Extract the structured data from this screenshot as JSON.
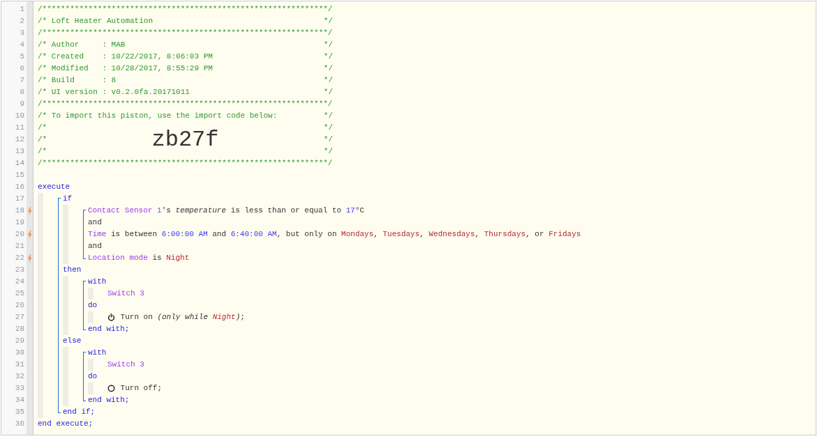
{
  "lines": [
    {
      "number": "1",
      "kind": "banner",
      "trigger": false,
      "tokens": [
        {
          "kind": "comment",
          "text": "/**************************************************************/"
        }
      ]
    },
    {
      "number": "2",
      "kind": "banner",
      "trigger": false,
      "tokens": [
        {
          "kind": "comment",
          "text": "/* Loft Heater Automation"
        },
        {
          "kind": "comment",
          "text": "*/"
        }
      ]
    },
    {
      "number": "3",
      "kind": "banner",
      "trigger": false,
      "tokens": [
        {
          "kind": "comment",
          "text": "/**************************************************************/"
        }
      ]
    },
    {
      "number": "4",
      "kind": "banner",
      "trigger": false,
      "tokens": [
        {
          "kind": "comment",
          "text": "/* Author     : MAB"
        },
        {
          "kind": "comment",
          "text": "*/"
        }
      ]
    },
    {
      "number": "5",
      "kind": "banner",
      "trigger": false,
      "tokens": [
        {
          "kind": "comment",
          "text": "/* Created    : 10/22/2017, 8:06:03 PM"
        },
        {
          "kind": "comment",
          "text": "*/"
        }
      ]
    },
    {
      "number": "6",
      "kind": "banner",
      "trigger": false,
      "tokens": [
        {
          "kind": "comment",
          "text": "/* Modified   : 10/28/2017, 8:55:29 PM"
        },
        {
          "kind": "comment",
          "text": "*/"
        }
      ]
    },
    {
      "number": "7",
      "kind": "banner",
      "trigger": false,
      "tokens": [
        {
          "kind": "comment",
          "text": "/* Build      : 8"
        },
        {
          "kind": "comment",
          "text": "*/"
        }
      ]
    },
    {
      "number": "8",
      "kind": "banner",
      "trigger": false,
      "tokens": [
        {
          "kind": "comment",
          "text": "/* UI version : v0.2.0fa.20171011"
        },
        {
          "kind": "comment",
          "text": "*/"
        }
      ]
    },
    {
      "number": "9",
      "kind": "banner",
      "trigger": false,
      "tokens": [
        {
          "kind": "comment",
          "text": "/**************************************************************/"
        }
      ]
    },
    {
      "number": "10",
      "kind": "banner",
      "trigger": false,
      "tokens": [
        {
          "kind": "comment",
          "text": "/* To import this piston, use the import code below:"
        },
        {
          "kind": "comment",
          "text": "*/"
        }
      ]
    },
    {
      "number": "11",
      "kind": "banner",
      "trigger": false,
      "tokens": [
        {
          "kind": "comment",
          "text": "/*"
        },
        {
          "kind": "comment",
          "text": "*/"
        }
      ]
    },
    {
      "number": "12",
      "kind": "banner",
      "trigger": false,
      "tokens": [
        {
          "kind": "comment",
          "text": "/*"
        },
        {
          "kind": "import_code",
          "text": "zb27f"
        },
        {
          "kind": "comment",
          "text": "*/"
        }
      ]
    },
    {
      "number": "13",
      "kind": "banner",
      "trigger": false,
      "tokens": [
        {
          "kind": "comment",
          "text": "/*"
        },
        {
          "kind": "comment",
          "text": "*/"
        }
      ]
    },
    {
      "number": "14",
      "kind": "banner",
      "trigger": false,
      "tokens": [
        {
          "kind": "comment",
          "text": "/**************************************************************/"
        }
      ]
    },
    {
      "number": "15",
      "kind": "code",
      "trigger": false
    },
    {
      "number": "16",
      "kind": "code",
      "trigger": false,
      "tokens": [
        {
          "kind": "keyword",
          "text": "execute"
        }
      ],
      "children": [
        {
          "kind": "block",
          "children": [
            {
              "number": "17",
              "kind": "code",
              "trigger": false,
              "tokens": [
                {
                  "kind": "keyword",
                  "text": "if"
                }
              ],
              "children": [
                {
                  "kind": "block",
                  "children": [
                    {
                      "number": "18",
                      "kind": "code",
                      "trigger": true,
                      "tokens": [
                        {
                          "kind": "device",
                          "text": "Contact Sensor 1"
                        },
                        {
                          "kind": "text",
                          "text": "'s "
                        },
                        {
                          "kind": "attribute",
                          "text": "temperature"
                        },
                        {
                          "kind": "text",
                          "text": " is less than or equal to "
                        },
                        {
                          "kind": "number",
                          "text": "17"
                        },
                        {
                          "kind": "text",
                          "text": "°C"
                        }
                      ]
                    },
                    {
                      "number": "19",
                      "kind": "code",
                      "trigger": false,
                      "tokens": [
                        {
                          "kind": "text",
                          "text": "and"
                        }
                      ]
                    },
                    {
                      "number": "20",
                      "kind": "code",
                      "trigger": true,
                      "tokens": [
                        {
                          "kind": "device",
                          "text": "Time"
                        },
                        {
                          "kind": "text",
                          "text": " is between "
                        },
                        {
                          "kind": "number",
                          "text": "6:00:00 AM"
                        },
                        {
                          "kind": "text",
                          "text": " and "
                        },
                        {
                          "kind": "number",
                          "text": "6:40:00 AM"
                        },
                        {
                          "kind": "text",
                          "text": ", but only on "
                        },
                        {
                          "kind": "value",
                          "text": "Mondays"
                        },
                        {
                          "kind": "text",
                          "text": ", "
                        },
                        {
                          "kind": "value",
                          "text": "Tuesdays"
                        },
                        {
                          "kind": "text",
                          "text": ", "
                        },
                        {
                          "kind": "value",
                          "text": "Wednesdays"
                        },
                        {
                          "kind": "text",
                          "text": ", "
                        },
                        {
                          "kind": "value",
                          "text": "Thursdays"
                        },
                        {
                          "kind": "text",
                          "text": ", or "
                        },
                        {
                          "kind": "value",
                          "text": "Fridays"
                        }
                      ]
                    },
                    {
                      "number": "21",
                      "kind": "code",
                      "trigger": false,
                      "tokens": [
                        {
                          "kind": "text",
                          "text": "and"
                        }
                      ]
                    },
                    {
                      "number": "22",
                      "kind": "code",
                      "trigger": true,
                      "tokens": [
                        {
                          "kind": "device",
                          "text": "Location mode"
                        },
                        {
                          "kind": "text",
                          "text": " is "
                        },
                        {
                          "kind": "value",
                          "text": "Night"
                        }
                      ]
                    }
                  ]
                }
              ]
            },
            {
              "number": "23",
              "kind": "code",
              "trigger": false,
              "tokens": [
                {
                  "kind": "keyword",
                  "text": "then"
                }
              ],
              "children": [
                {
                  "kind": "block",
                  "children": [
                    {
                      "number": "24",
                      "kind": "code",
                      "trigger": false,
                      "tokens": [
                        {
                          "kind": "keyword",
                          "text": "with"
                        }
                      ],
                      "children": [
                        {
                          "number": "25",
                          "kind": "code",
                          "trigger": false,
                          "tokens": [
                            {
                              "kind": "device",
                              "text": "Switch 3"
                            }
                          ]
                        }
                      ]
                    },
                    {
                      "number": "26",
                      "kind": "code",
                      "trigger": false,
                      "tokens": [
                        {
                          "kind": "keyword",
                          "text": "do"
                        }
                      ],
                      "children": [
                        {
                          "number": "27",
                          "kind": "code",
                          "trigger": false,
                          "tokens": [
                            {
                              "kind": "icon_on"
                            },
                            {
                              "kind": "text",
                              "text": " Turn on "
                            },
                            {
                              "kind": "aside",
                              "text": "(only while "
                            },
                            {
                              "kind": "aside_value",
                              "text": "Night"
                            },
                            {
                              "kind": "aside",
                              "text": ")"
                            },
                            {
                              "kind": "text",
                              "text": ";"
                            }
                          ]
                        }
                      ]
                    },
                    {
                      "number": "28",
                      "kind": "code",
                      "trigger": false,
                      "tokens": [
                        {
                          "kind": "keyword",
                          "text": "end with;"
                        }
                      ]
                    }
                  ]
                }
              ]
            },
            {
              "number": "29",
              "kind": "code",
              "trigger": false,
              "tokens": [
                {
                  "kind": "keyword",
                  "text": "else"
                }
              ],
              "children": [
                {
                  "kind": "block",
                  "children": [
                    {
                      "number": "30",
                      "kind": "code",
                      "trigger": false,
                      "tokens": [
                        {
                          "kind": "keyword",
                          "text": "with"
                        }
                      ],
                      "children": [
                        {
                          "number": "31",
                          "kind": "code",
                          "trigger": false,
                          "tokens": [
                            {
                              "kind": "device",
                              "text": "Switch 3"
                            }
                          ]
                        }
                      ]
                    },
                    {
                      "number": "32",
                      "kind": "code",
                      "trigger": false,
                      "tokens": [
                        {
                          "kind": "keyword",
                          "text": "do"
                        }
                      ],
                      "children": [
                        {
                          "number": "33",
                          "kind": "code",
                          "trigger": false,
                          "tokens": [
                            {
                              "kind": "icon_off"
                            },
                            {
                              "kind": "text",
                              "text": " Turn off;"
                            }
                          ]
                        }
                      ]
                    },
                    {
                      "number": "34",
                      "kind": "code",
                      "trigger": false,
                      "tokens": [
                        {
                          "kind": "keyword",
                          "text": "end with;"
                        }
                      ]
                    }
                  ]
                }
              ]
            },
            {
              "number": "35",
              "kind": "code",
              "trigger": false,
              "tokens": [
                {
                  "kind": "keyword",
                  "text": "end if;"
                }
              ]
            }
          ]
        }
      ]
    },
    {
      "number": "36",
      "kind": "code",
      "trigger": false,
      "tokens": [
        {
          "kind": "keyword",
          "text": "end execute;"
        }
      ]
    }
  ]
}
